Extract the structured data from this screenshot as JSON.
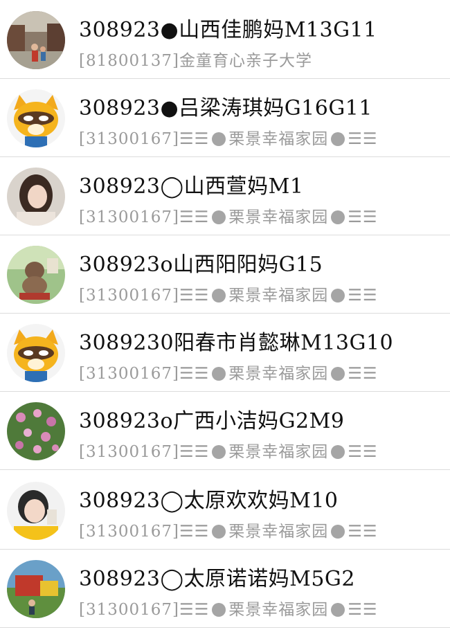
{
  "contacts": [
    {
      "title": "308923●山西佳鹏妈M13G11",
      "subtitle": "[81800137]金童育心亲子大学",
      "avatar": "street-photo-avatar"
    },
    {
      "title": "308923●吕梁涛琪妈G16G11",
      "sub_id": "[31300167]",
      "sub_pre": "☰☰",
      "sub_name": "栗景幸福家园",
      "sub_post": "☰☰",
      "avatar": "raccoon-cartoon-avatar"
    },
    {
      "title": "308923◯山西萱妈M1",
      "sub_id": "[31300167]",
      "sub_pre": "☰☰",
      "sub_name": "栗景幸福家园",
      "sub_post": "☰☰",
      "avatar": "woman-portrait-avatar"
    },
    {
      "title": "308923o山西阳阳妈G15",
      "sub_id": "[31300167]",
      "sub_pre": "☰☰",
      "sub_name": "栗景幸福家园",
      "sub_post": "☰☰",
      "avatar": "figurine-avatar"
    },
    {
      "title": "3089230阳春市肖懿琳M13G10",
      "sub_id": "[31300167]",
      "sub_pre": "☰☰",
      "sub_name": "栗景幸福家园",
      "sub_post": "☰☰",
      "avatar": "raccoon-cartoon-avatar"
    },
    {
      "title": "308923o广西小洁妈G2M9",
      "sub_id": "[31300167]",
      "sub_pre": "☰☰",
      "sub_name": "栗景幸福家园",
      "sub_post": "☰☰",
      "avatar": "flowers-avatar"
    },
    {
      "title": "308923◯太原欢欢妈M10",
      "sub_id": "[31300167]",
      "sub_pre": "☰☰",
      "sub_name": "栗景幸福家园",
      "sub_post": "☰☰",
      "avatar": "child-portrait-avatar"
    },
    {
      "title": "308923◯太原诺诺妈M5G2",
      "sub_id": "[31300167]",
      "sub_pre": "☰☰",
      "sub_name": "栗景幸福家园",
      "sub_post": "☰☰",
      "avatar": "playground-avatar"
    }
  ]
}
